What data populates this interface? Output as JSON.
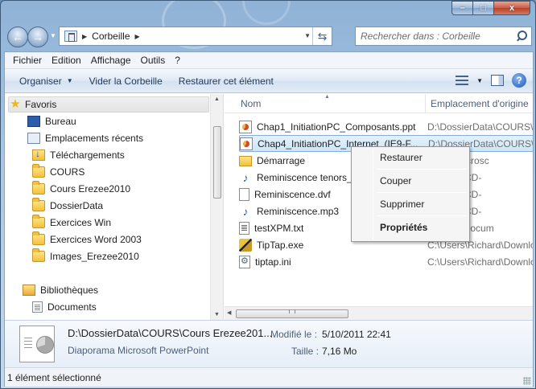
{
  "window": {
    "caption_buttons": {
      "minimize": "–",
      "maximize": "□",
      "close": "x"
    }
  },
  "nav": {
    "back_icon": "back-arrow-icon",
    "forward_icon": "forward-arrow-icon",
    "address": {
      "current": "Corbeille"
    },
    "search": {
      "placeholder": "Rechercher dans : Corbeille"
    }
  },
  "menubar": {
    "items": [
      "Fichier",
      "Edition",
      "Affichage",
      "Outils",
      "?"
    ]
  },
  "toolbar": {
    "organize": "Organiser",
    "empty_bin": "Vider la Corbeille",
    "restore_item": "Restaurer cet élément"
  },
  "sidebar": {
    "favorites_label": "Favoris",
    "items": [
      {
        "label": "Bureau",
        "icon": "desktop-icon"
      },
      {
        "label": "Emplacements récents",
        "icon": "recent-places-icon"
      },
      {
        "label": "Téléchargements",
        "icon": "downloads-folder-icon"
      },
      {
        "label": "COURS",
        "icon": "folder-icon"
      },
      {
        "label": "Cours Erezee2010",
        "icon": "folder-icon"
      },
      {
        "label": "DossierData",
        "icon": "folder-icon"
      },
      {
        "label": "Exercices Win",
        "icon": "folder-icon"
      },
      {
        "label": "Exercices Word 2003",
        "icon": "folder-icon"
      },
      {
        "label": "Images_Erezee2010",
        "icon": "folder-icon"
      }
    ],
    "libraries_label": "Bibliothèques",
    "library_items": [
      {
        "label": "Documents",
        "icon": "documents-library-icon"
      }
    ]
  },
  "filelist": {
    "columns": {
      "name": "Nom",
      "location": "Emplacement d'origine"
    },
    "rows": [
      {
        "name": "Chap1_InitiationPC_Composants.ppt",
        "location": "D:\\DossierData\\COURS\\C",
        "icon": "powerpoint-file-icon"
      },
      {
        "name": "Chap4_InitiationPC_Internet_(IE9-F...",
        "location": "D:\\DossierData\\COURS\\C",
        "icon": "powerpoint-file-icon"
      },
      {
        "name": "Démarrage",
        "location": "nData\\Microsc",
        "icon": "folder-icon"
      },
      {
        "name": "Reminiscence tenors_2",
        "location": "uments\\ICD-",
        "icon": "audio-file-icon"
      },
      {
        "name": "Reminiscence.dvf",
        "location": "uments\\ICD-",
        "icon": "generic-file-icon"
      },
      {
        "name": "Reminiscence.mp3",
        "location": "uments\\ICD-",
        "icon": "audio-file-icon"
      },
      {
        "name": "testXPM.txt",
        "location": "Richard\\Docum",
        "icon": "text-file-icon"
      },
      {
        "name": "TipTap.exe",
        "location": "C:\\Users\\Richard\\Downlo",
        "icon": "executable-icon"
      },
      {
        "name": "tiptap.ini",
        "location": "C:\\Users\\Richard\\Downlo",
        "icon": "ini-settings-icon"
      }
    ]
  },
  "context_menu": {
    "restore": "Restaurer",
    "cut": "Couper",
    "delete": "Supprimer",
    "properties": "Propriétés"
  },
  "details": {
    "name": "D:\\DossierData\\COURS\\Cours Erezee201...",
    "type": "Diaporama Microsoft PowerPoint",
    "modified_label": "Modifié le :",
    "modified_value": "5/10/2011 22:41",
    "size_label": "Taille :",
    "size_value": "7,16 Mo"
  },
  "status": {
    "text": "1 élément sélectionné"
  }
}
